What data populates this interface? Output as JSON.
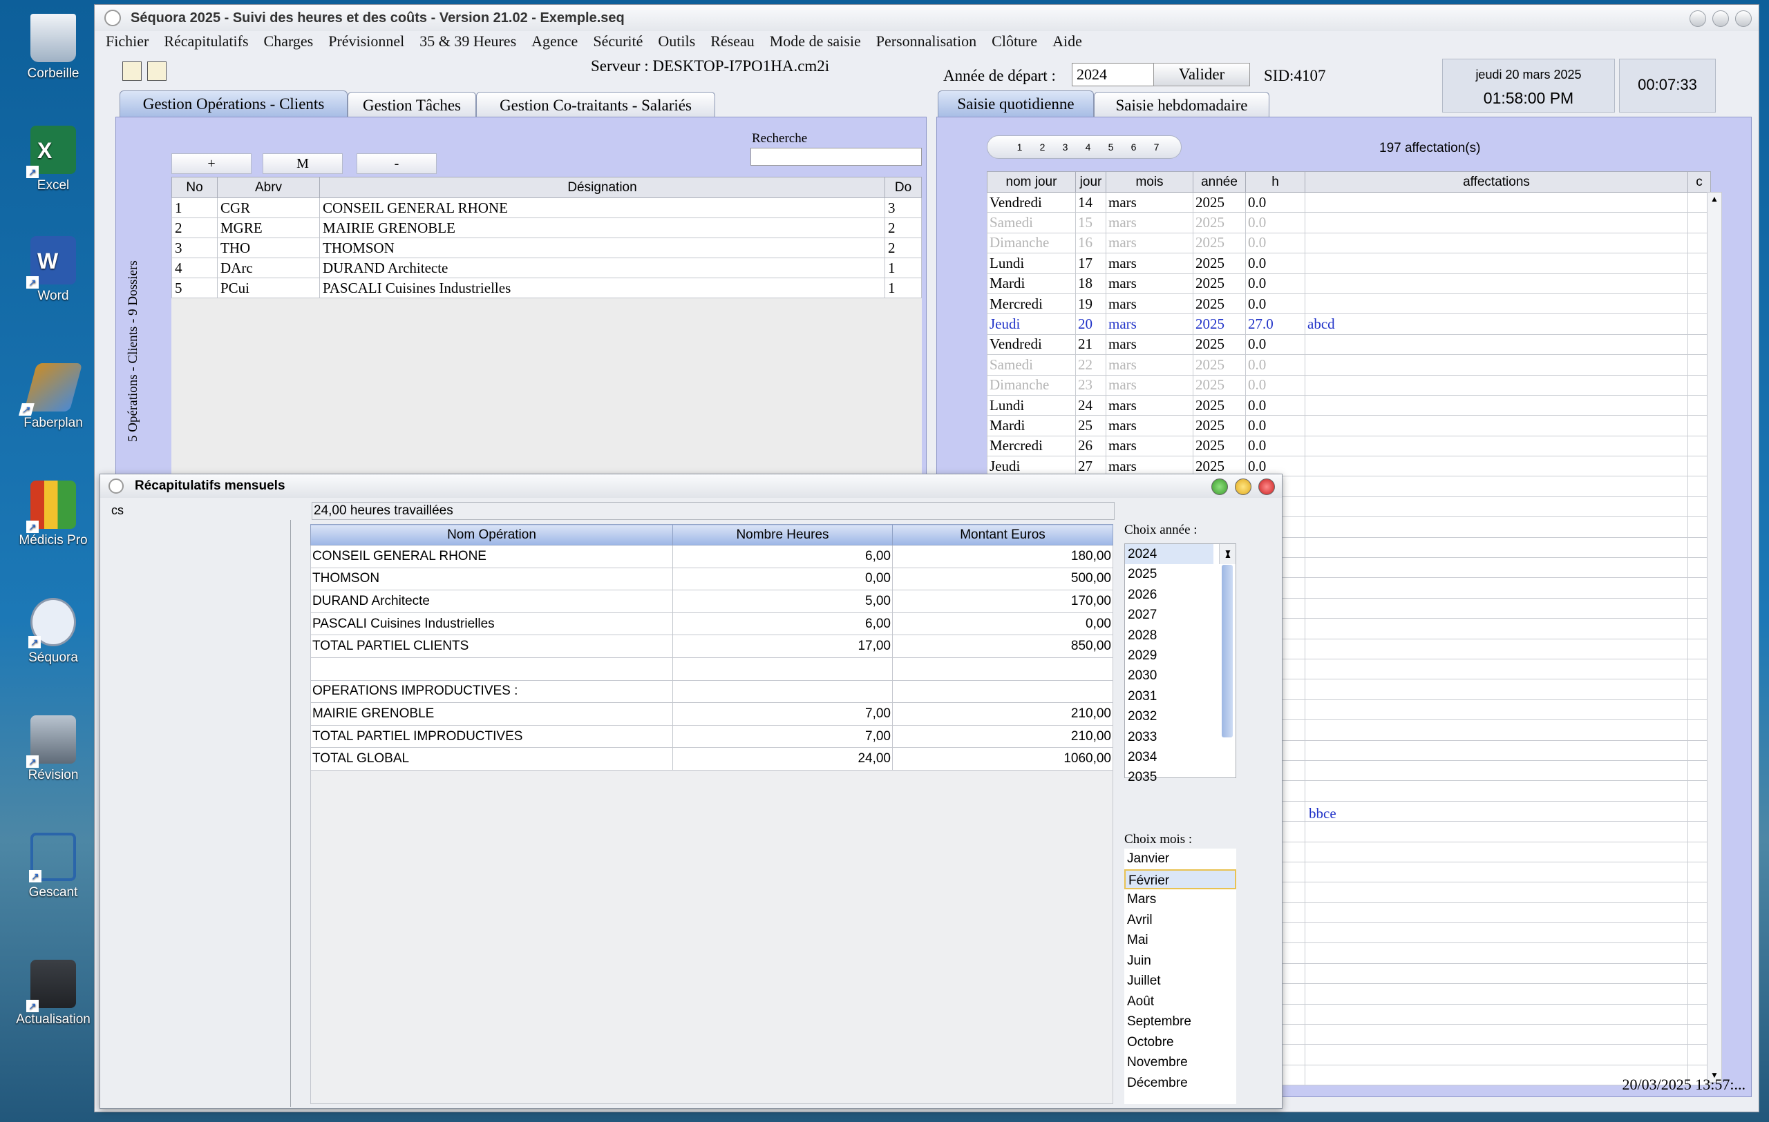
{
  "desktop": {
    "icons": [
      {
        "label": "Corbeille",
        "icon": "recycle-bin-icon"
      },
      {
        "label": "Excel",
        "icon": "excel-icon"
      },
      {
        "label": "Word",
        "icon": "word-icon"
      },
      {
        "label": "Faberplan",
        "icon": "faberplan-icon"
      },
      {
        "label": "Médicis Pro",
        "icon": "medicis-icon"
      },
      {
        "label": "Séquora",
        "icon": "sequora-icon"
      },
      {
        "label": "Révision",
        "icon": "calculator-icon"
      },
      {
        "label": "Gescant",
        "icon": "crane-icon"
      },
      {
        "label": "Actualisation",
        "icon": "card-terminal-icon"
      }
    ]
  },
  "window": {
    "title": "Séquora 2025 - Suivi des heures et des coûts - Version 21.02 - Exemple.seq",
    "menu": [
      "Fichier",
      "Récapitulatifs",
      "Charges",
      "Prévisionnel",
      "35 & 39 Heures",
      "Agence",
      "Sécurité",
      "Outils",
      "Réseau",
      "Mode de saisie",
      "Personnalisation",
      "Clôture",
      "Aide"
    ]
  },
  "header": {
    "server": "Serveur : DESKTOP-I7PO1HA.cm2i",
    "annee_label": "Année de départ :",
    "annee_value": "2024",
    "valider": "Valider",
    "sid": "SID:4107",
    "date": "jeudi 20 mars 2025",
    "time": "01:58:00 PM",
    "elapsed": "00:07:33"
  },
  "left_tabs": [
    "Gestion Opérations - Clients",
    "Gestion Tâches",
    "Gestion Co-traitants - Salariés"
  ],
  "right_tabs": [
    "Saisie quotidienne",
    "Saisie hebdomadaire"
  ],
  "operations": {
    "buttons": [
      "+",
      "M",
      "-"
    ],
    "search_label": "Recherche",
    "side_label": "5 Opérations - Clients - 9 Dossiers",
    "columns": [
      "No",
      "Abrv",
      "Désignation",
      "Do"
    ],
    "rows": [
      [
        "1",
        "CGR",
        "CONSEIL GENERAL RHONE",
        "3"
      ],
      [
        "2",
        "MGRE",
        "MAIRIE GRENOBLE",
        "2"
      ],
      [
        "3",
        "THO",
        "THOMSON",
        "2"
      ],
      [
        "4",
        "DArc",
        "DURAND Architecte",
        "1"
      ],
      [
        "5",
        "PCui",
        "PASCALI Cuisines Industrielles",
        "1"
      ]
    ]
  },
  "saisie": {
    "pages": [
      "1",
      "2",
      "3",
      "4",
      "5",
      "6",
      "7"
    ],
    "count": "197 affectation(s)",
    "columns": [
      "nom jour",
      "jour",
      "mois",
      "année",
      "h",
      "affectations",
      "c"
    ],
    "rows": [
      {
        "cells": [
          "Vendredi",
          "14",
          "mars",
          "2025",
          "0.0",
          ""
        ],
        "kind": ""
      },
      {
        "cells": [
          "Samedi",
          "15",
          "mars",
          "2025",
          "0.0",
          ""
        ],
        "kind": "we"
      },
      {
        "cells": [
          "Dimanche",
          "16",
          "mars",
          "2025",
          "0.0",
          ""
        ],
        "kind": "we"
      },
      {
        "cells": [
          "Lundi",
          "17",
          "mars",
          "2025",
          "0.0",
          ""
        ],
        "kind": ""
      },
      {
        "cells": [
          "Mardi",
          "18",
          "mars",
          "2025",
          "0.0",
          ""
        ],
        "kind": ""
      },
      {
        "cells": [
          "Mercredi",
          "19",
          "mars",
          "2025",
          "0.0",
          ""
        ],
        "kind": ""
      },
      {
        "cells": [
          "Jeudi",
          "20",
          "mars",
          "2025",
          "27.0",
          "abcd"
        ],
        "kind": "today"
      },
      {
        "cells": [
          "Vendredi",
          "21",
          "mars",
          "2025",
          "0.0",
          ""
        ],
        "kind": ""
      },
      {
        "cells": [
          "Samedi",
          "22",
          "mars",
          "2025",
          "0.0",
          ""
        ],
        "kind": "we"
      },
      {
        "cells": [
          "Dimanche",
          "23",
          "mars",
          "2025",
          "0.0",
          ""
        ],
        "kind": "we"
      },
      {
        "cells": [
          "Lundi",
          "24",
          "mars",
          "2025",
          "0.0",
          ""
        ],
        "kind": ""
      },
      {
        "cells": [
          "Mardi",
          "25",
          "mars",
          "2025",
          "0.0",
          ""
        ],
        "kind": ""
      },
      {
        "cells": [
          "Mercredi",
          "26",
          "mars",
          "2025",
          "0.0",
          ""
        ],
        "kind": ""
      },
      {
        "cells": [
          "Jeudi",
          "27",
          "mars",
          "2025",
          "0.0",
          ""
        ],
        "kind": ""
      }
    ],
    "hidden_affectation": "bbce",
    "status": "20/03/2025 13:57:..."
  },
  "recap": {
    "title": "Récapitulatifs mensuels",
    "cs": "cs",
    "hours": "24,00 heures travaillées",
    "columns": [
      "Nom Opération",
      "Nombre Heures",
      "Montant Euros"
    ],
    "rows": [
      [
        "CONSEIL GENERAL RHONE",
        "6,00",
        "180,00"
      ],
      [
        "THOMSON",
        "0,00",
        "500,00"
      ],
      [
        "DURAND Architecte",
        "5,00",
        "170,00"
      ],
      [
        "PASCALI Cuisines Industrielles",
        "6,00",
        "0,00"
      ],
      [
        "TOTAL PARTIEL CLIENTS",
        "17,00",
        "850,00"
      ],
      [
        "",
        "",
        ""
      ],
      [
        "OPERATIONS IMPRODUCTIVES :",
        "",
        ""
      ],
      [
        "MAIRIE GRENOBLE",
        "7,00",
        "210,00"
      ],
      [
        "TOTAL PARTIEL IMPRODUCTIVES",
        "7,00",
        "210,00"
      ],
      [
        "TOTAL GLOBAL",
        "24,00",
        "1060,00"
      ]
    ],
    "choix_annee_label": "Choix année :",
    "years": [
      "2024",
      "2025",
      "2026",
      "2027",
      "2028",
      "2029",
      "2030",
      "2031",
      "2032",
      "2033",
      "2034",
      "2035"
    ],
    "selected_year": "2024",
    "choix_mois_label": "Choix mois :",
    "months": [
      "Janvier",
      "Février",
      "Mars",
      "Avril",
      "Mai",
      "Juin",
      "Juillet",
      "Août",
      "Septembre",
      "Octobre",
      "Novembre",
      "Décembre"
    ],
    "selected_month": "Février"
  }
}
